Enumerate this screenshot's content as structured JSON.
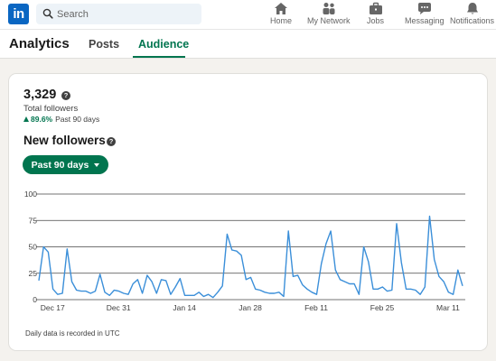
{
  "nav": {
    "logo_text": "in",
    "search_placeholder": "Search",
    "items": [
      {
        "label": "Home",
        "icon": "home-icon"
      },
      {
        "label": "My Network",
        "icon": "network-icon"
      },
      {
        "label": "Jobs",
        "icon": "briefcase-icon"
      },
      {
        "label": "Messaging",
        "icon": "messaging-icon"
      },
      {
        "label": "Notifications",
        "icon": "bell-icon"
      }
    ]
  },
  "subnav": {
    "title": "Analytics",
    "tabs": [
      {
        "label": "Posts",
        "active": false
      },
      {
        "label": "Audience",
        "active": true
      }
    ]
  },
  "card": {
    "total_followers": "3,329",
    "total_followers_label": "Total followers",
    "change_percent": "89.6%",
    "change_period": "Past 90 days",
    "section_title": "New followers",
    "range_button": "Past 90 days",
    "footnote": "Daily data is recorded in UTC"
  },
  "colors": {
    "accent_green": "#01754f",
    "line_blue": "#3b8fd9",
    "brand_blue": "#0a66c2"
  },
  "chart_data": {
    "type": "line",
    "title": "",
    "xlabel": "",
    "ylabel": "",
    "ylim": [
      0,
      100
    ],
    "yticks": [
      0,
      25,
      50,
      75,
      100
    ],
    "xtick_labels": [
      "Dec 17",
      "Dec 31",
      "Jan 14",
      "Jan 28",
      "Feb 11",
      "Feb 25",
      "Mar 11"
    ],
    "xtick_day_index": [
      1,
      15,
      29,
      43,
      57,
      71,
      85
    ],
    "series": [
      {
        "values": [
          18,
          50,
          45,
          10,
          5,
          6,
          48,
          17,
          9,
          8,
          8,
          6,
          8,
          24,
          7,
          4,
          9,
          8,
          6,
          5,
          15,
          19,
          6,
          23,
          17,
          6,
          19,
          18,
          5,
          12,
          20,
          4,
          4,
          4,
          7,
          3,
          5,
          2,
          7,
          13,
          62,
          47,
          46,
          42,
          19,
          21,
          10,
          9,
          7,
          6,
          6,
          7,
          3,
          65,
          22,
          23,
          14,
          10,
          7,
          5,
          34,
          53,
          65,
          28,
          19,
          17,
          15,
          15,
          5,
          50,
          36,
          10,
          10,
          12,
          8,
          9,
          72,
          35,
          10,
          10,
          9,
          5,
          12,
          79,
          38,
          22,
          17,
          7,
          5,
          28,
          13
        ]
      }
    ]
  }
}
